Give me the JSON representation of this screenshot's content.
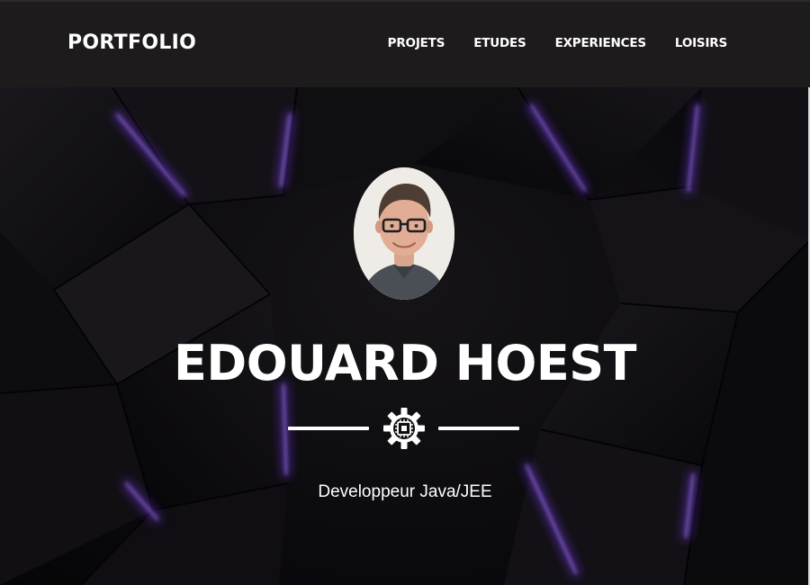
{
  "navbar": {
    "brand": "PORTFOLIO",
    "links": [
      {
        "label": "PROJETS"
      },
      {
        "label": "ETUDES"
      },
      {
        "label": "EXPERIENCES"
      },
      {
        "label": "LOISIRS"
      }
    ]
  },
  "hero": {
    "name": "EDOUARD HOEST",
    "subtitle": "Developpeur Java/JEE",
    "divider_icon": "gear-chip-icon",
    "avatar": "profile-photo"
  },
  "colors": {
    "navbar_bg": "#1e1b1c",
    "hero_bg": "#0c0b0e",
    "accent_glow": "#7b3cff",
    "text": "#ffffff"
  }
}
